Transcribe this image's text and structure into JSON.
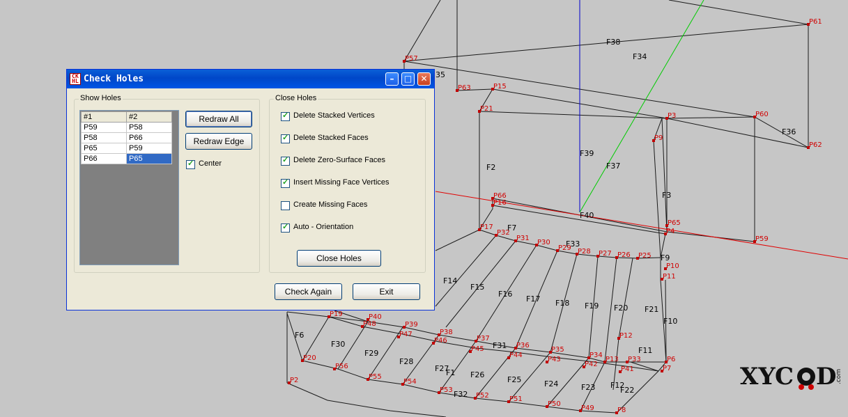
{
  "dialog": {
    "title": "Check Holes",
    "show_holes": {
      "legend": "Show Holes",
      "columns": [
        "#1",
        "#2"
      ],
      "rows": [
        [
          "P59",
          "P58"
        ],
        [
          "P58",
          "P66"
        ],
        [
          "P65",
          "P59"
        ],
        [
          "P66",
          "P65"
        ]
      ],
      "selected": "P65"
    },
    "redraw_all_label": "Redraw All",
    "redraw_edge_label": "Redraw Edge",
    "center": {
      "label": "Center",
      "checked": true
    },
    "close_holes_group": {
      "legend": "Close Holes",
      "options": [
        {
          "label": "Delete Stacked Vertices",
          "checked": true
        },
        {
          "label": "Delete Stacked Faces",
          "checked": true
        },
        {
          "label": "Delete Zero-Surface Faces",
          "checked": true
        },
        {
          "label": "Insert Missing Face Vertices",
          "checked": true
        },
        {
          "label": "Create Missing Faces",
          "checked": false
        },
        {
          "label": "Auto - Orientation",
          "checked": true
        }
      ]
    },
    "close_holes_label": "Close Holes",
    "check_again_label": "Check Again",
    "exit_label": "Exit"
  },
  "scene": {
    "points": [
      "P61",
      "P57",
      "P63",
      "P15",
      "P21",
      "P3",
      "P60",
      "P9",
      "P62",
      "P66",
      "P16",
      "P65",
      "P4",
      "P17",
      "P32",
      "P31",
      "P30",
      "P29",
      "P28",
      "P27",
      "P26",
      "P25",
      "P10",
      "P11",
      "P19",
      "P40",
      "P48",
      "P39",
      "P47",
      "P38",
      "P46",
      "P37",
      "P45",
      "P36",
      "P44",
      "P35",
      "P43",
      "P34",
      "P42",
      "P13",
      "P33",
      "P12",
      "P41",
      "P6",
      "P7",
      "P20",
      "P56",
      "P55",
      "P54",
      "P53",
      "P52",
      "P51",
      "P50",
      "P49",
      "P8",
      "P2",
      "P59"
    ],
    "faces": [
      "F38",
      "F34",
      "F36",
      "F39",
      "F37",
      "F2",
      "F3",
      "F40",
      "F7",
      "F33",
      "F9",
      "F14",
      "F15",
      "F16",
      "F17",
      "F18",
      "F19",
      "F20",
      "F21",
      "F10",
      "F6",
      "F30",
      "F29",
      "F28",
      "F27",
      "F31",
      "F1",
      "F26",
      "F25",
      "F24",
      "F23",
      "F22",
      "F12",
      "F11",
      "F32",
      "35"
    ]
  },
  "watermark": "XYCAD.com",
  "colors": {
    "title_bar": "#0054e3",
    "selection": "#316ac5",
    "point_label": "#d00000",
    "axis_x": "#e00000",
    "axis_y": "#00cc00",
    "axis_z": "#0000cc"
  }
}
